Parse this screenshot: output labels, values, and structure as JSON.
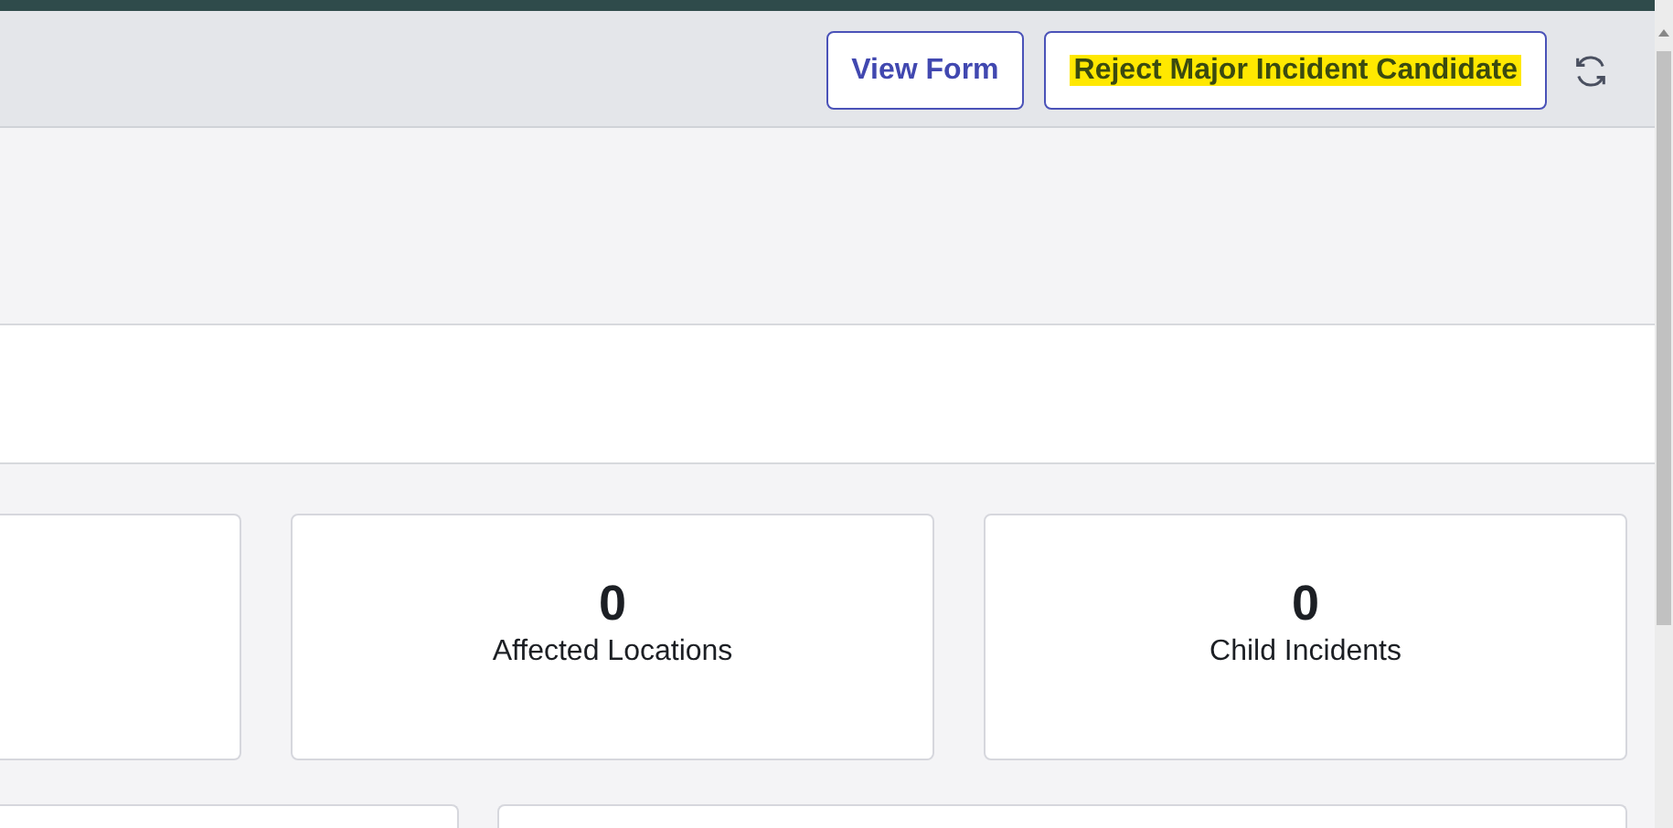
{
  "header": {
    "buttons": [
      {
        "label": "View Form",
        "highlighted": false
      },
      {
        "label": "Reject Major Incident Candidate",
        "highlighted": true
      }
    ]
  },
  "stats": [
    {
      "kind": "cut"
    },
    {
      "value": "0",
      "label": "Affected Locations",
      "kind": "stat"
    },
    {
      "value": "0",
      "label": "Child Incidents",
      "kind": "stat"
    }
  ]
}
